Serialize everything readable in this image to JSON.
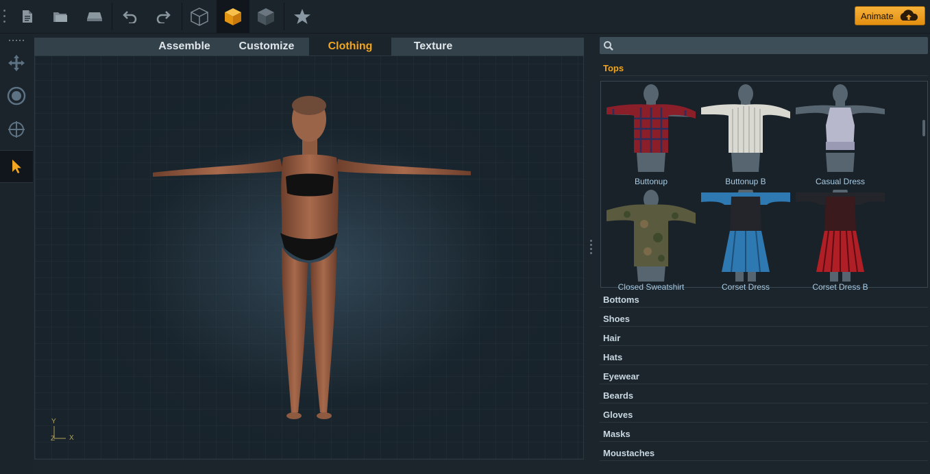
{
  "toolbar": {
    "buttons": [
      "new-file-icon",
      "open-folder-icon",
      "save-icon",
      "undo-icon",
      "redo-icon",
      "wireframe-cube-icon",
      "solid-cube-icon",
      "dark-cube-icon",
      "star-icon"
    ],
    "animate_label": "Animate",
    "accent": "#f2a520"
  },
  "tabs": [
    {
      "label": "Assemble"
    },
    {
      "label": "Customize"
    },
    {
      "label": "Clothing"
    },
    {
      "label": "Texture"
    }
  ],
  "viewport": {
    "axis_y": "Y",
    "axis_x": "X",
    "axis_z": "Z"
  },
  "search": {
    "placeholder": ""
  },
  "categories": {
    "open": "Tops",
    "collapsed": [
      "Bottoms",
      "Shoes",
      "Hair",
      "Hats",
      "Eyewear",
      "Beards",
      "Gloves",
      "Masks",
      "Moustaches"
    ]
  },
  "tops_items": [
    {
      "label": "Buttonup",
      "color": "#8a1f2a"
    },
    {
      "label": "Buttonup B",
      "color": "#d9d9d2"
    },
    {
      "label": "Casual Dress",
      "color": "#b8b8cc"
    },
    {
      "label": "Closed Sweatshirt",
      "color": "#5a5a3e"
    },
    {
      "label": "Corset Dress",
      "color": "#2f79b2"
    },
    {
      "label": "Corset Dress B",
      "color": "#b01e26"
    }
  ]
}
